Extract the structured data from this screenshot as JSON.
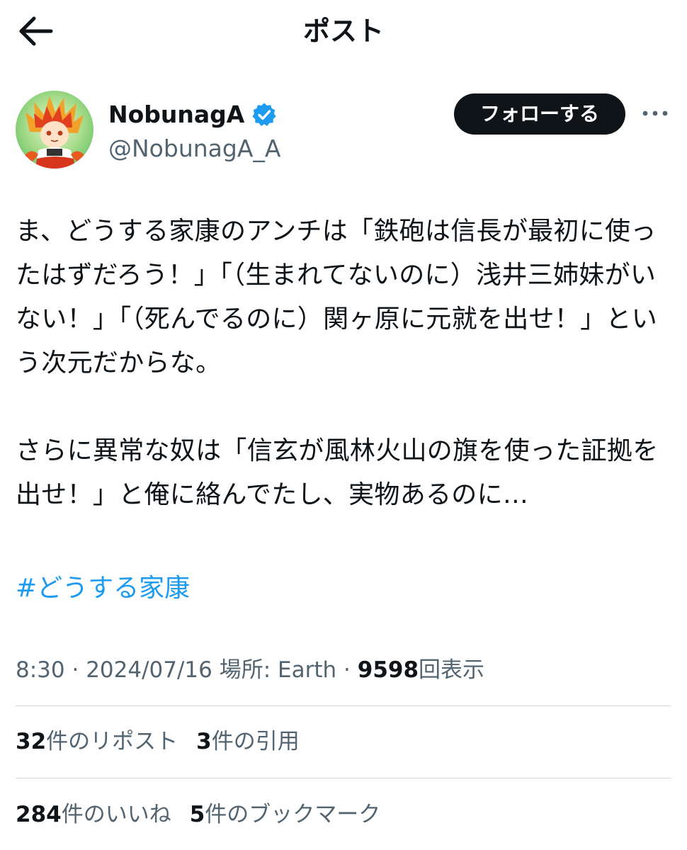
{
  "header": {
    "title": "ポスト"
  },
  "author": {
    "display_name": "NobunagA",
    "handle": "@NobunagA_A",
    "follow_label": "フォローする",
    "verified_color": "#1d9bf0"
  },
  "tweet": {
    "paragraphs": [
      "ま、どうする家康のアンチは「鉄砲は信長が最初に使ったはずだろう！」「（生まれてないのに）浅井三姉妹がいない！」「（死んでるのに）関ヶ原に元就を出せ！」という次元だからな。",
      "さらに異常な奴は「信玄が風林火山の旗を使った証拠を出せ！」と俺に絡んでたし、実物あるのに…"
    ],
    "hashtag": "#どうする家康"
  },
  "meta": {
    "time": "8:30",
    "date": "2024/07/16",
    "location": "場所: Earth",
    "views_count": "9598",
    "views_label": "回表示",
    "separator": "·"
  },
  "stats": {
    "reposts_count": "32",
    "reposts_label": "件のリポスト",
    "quotes_count": "3",
    "quotes_label": "件の引用",
    "likes_count": "284",
    "likes_label": "件のいいね",
    "bookmarks_count": "5",
    "bookmarks_label": "件のブックマーク"
  },
  "colors": {
    "text_primary": "#0f1419",
    "text_secondary": "#536471",
    "accent": "#1d9bf0",
    "divider": "#cfd9de"
  }
}
